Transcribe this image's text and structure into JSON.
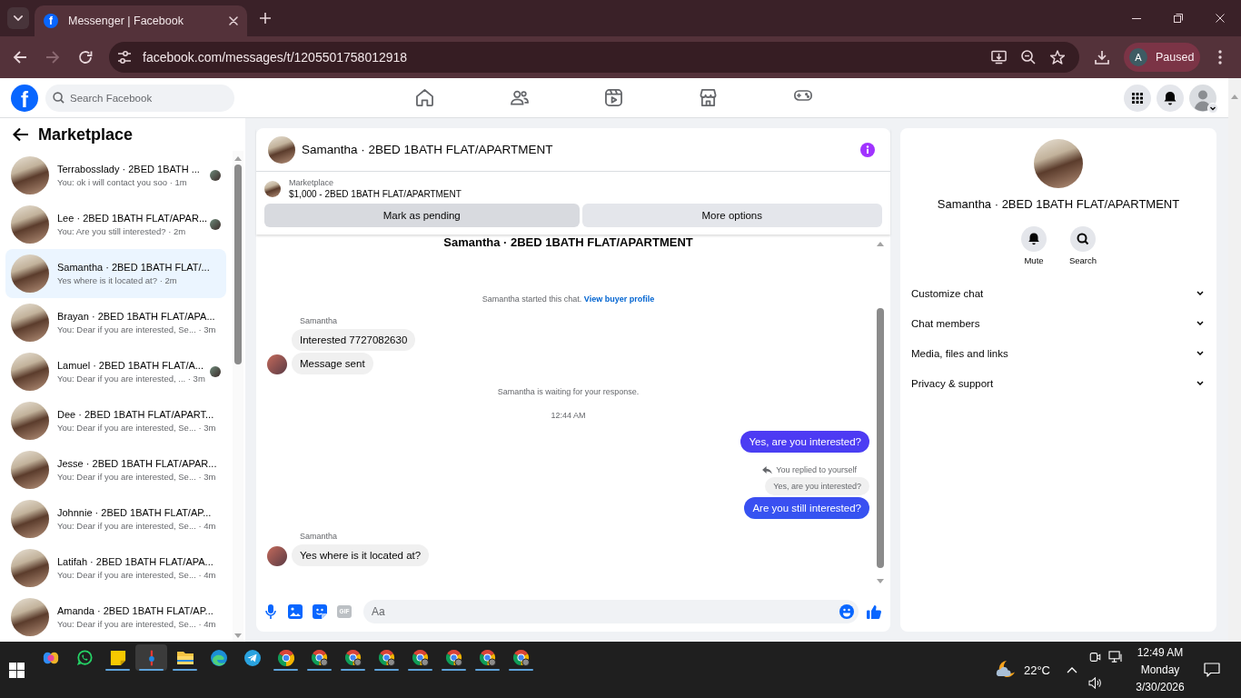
{
  "browser": {
    "tabs": [
      {
        "favicon_text": "f",
        "title": "Messenger | Facebook",
        "selected": true
      }
    ],
    "url": "facebook.com/messages/t/1205501758012918",
    "forward_disabled": true,
    "profile": {
      "initial": "A",
      "status": "Paused"
    }
  },
  "facebook": {
    "logo_text": "f",
    "search_placeholder": "Search Facebook"
  },
  "sidebar": {
    "title": "Marketplace",
    "conversations": [
      {
        "title": "Terrabosslady · 2BED 1BATH ...",
        "preview": "You: ok i will contact you soo · 1m",
        "selected": false,
        "seen": true
      },
      {
        "title": "Lee · 2BED 1BATH FLAT/APAR...",
        "preview": "You: Are you still interested? · 2m",
        "selected": false,
        "seen": true
      },
      {
        "title": "Samantha · 2BED 1BATH FLAT/...",
        "preview": "Yes where is it located at? · 2m",
        "selected": true,
        "seen": false
      },
      {
        "title": "Brayan · 2BED 1BATH FLAT/APA...",
        "preview": "You: Dear if you are interested, Se... · 3m",
        "selected": false,
        "seen": false
      },
      {
        "title": "Lamuel · 2BED 1BATH FLAT/A...",
        "preview": "You: Dear if you are interested, ... · 3m",
        "selected": false,
        "seen": true
      },
      {
        "title": "Dee · 2BED 1BATH FLAT/APART...",
        "preview": "You: Dear if you are interested, Se... · 3m",
        "selected": false,
        "seen": false
      },
      {
        "title": "Jesse · 2BED 1BATH FLAT/APAR...",
        "preview": "You: Dear if you are interested, Se... · 3m",
        "selected": false,
        "seen": false
      },
      {
        "title": "Johnnie · 2BED 1BATH FLAT/AP...",
        "preview": "You: Dear if you are interested, Se... · 4m",
        "selected": false,
        "seen": false
      },
      {
        "title": "Latifah · 2BED 1BATH FLAT/APA...",
        "preview": "You: Dear if you are interested, Se... · 4m",
        "selected": false,
        "seen": false
      },
      {
        "title": "Amanda · 2BED 1BATH FLAT/AP...",
        "preview": "You: Dear if you are interested, Se... · 4m",
        "selected": false,
        "seen": false
      }
    ]
  },
  "chat": {
    "title": "Samantha · 2BED 1BATH FLAT/APARTMENT",
    "listing": {
      "label": "Marketplace",
      "name": "$1,000 - 2BED 1BATH FLAT/APARTMENT"
    },
    "actions": [
      {
        "kind": "primary",
        "label": "Mark as pending"
      },
      {
        "kind": "secondary",
        "label": "More options"
      }
    ],
    "thread_title": "Samantha · 2BED 1BATH FLAT/APARTMENT",
    "messages": [
      {
        "kind": "notice",
        "text": "Samantha started this chat.",
        "link": "View buyer profile"
      },
      {
        "kind": "sender",
        "text": "Samantha"
      },
      {
        "kind": "incoming",
        "text": "Interested 7727082630",
        "avatar": false
      },
      {
        "kind": "incoming",
        "text": "Message sent",
        "avatar": true
      },
      {
        "kind": "notice",
        "text": "Samantha is waiting for your response."
      },
      {
        "kind": "timestamp",
        "text": "12:44 AM"
      },
      {
        "kind": "outgoing",
        "text": "Yes, are you interested?"
      },
      {
        "kind": "reply_note",
        "text": "You replied to yourself",
        "quote": "Yes, are you interested?"
      },
      {
        "kind": "outgoing",
        "text": "Are you still interested?"
      },
      {
        "kind": "sender",
        "text": "Samantha"
      },
      {
        "kind": "incoming",
        "text": "Yes where is it located at?",
        "avatar": true
      }
    ],
    "composer": {
      "gif_label": "GIF",
      "placeholder": "Aa"
    }
  },
  "details": {
    "title": "Samantha · 2BED 1BATH FLAT/APARTMENT",
    "actions": [
      {
        "kind": "mute",
        "label": "Mute"
      },
      {
        "kind": "search",
        "label": "Search"
      }
    ],
    "sections": [
      {
        "label": "Customize chat",
        "expanded": false
      },
      {
        "label": "Chat members",
        "expanded": false
      },
      {
        "label": "Media, files and links",
        "expanded": false
      },
      {
        "label": "Privacy & support",
        "expanded": false
      }
    ]
  },
  "taskbar": {
    "apps": [
      {
        "kind": "assistant",
        "running": false,
        "active": false
      },
      {
        "kind": "chat",
        "running": false,
        "active": false
      },
      {
        "kind": "notes",
        "running": true,
        "active": false
      },
      {
        "kind": "pin",
        "running": true,
        "active": true
      },
      {
        "kind": "folder",
        "running": true,
        "active": false
      },
      {
        "kind": "swirl",
        "running": false,
        "active": false
      },
      {
        "kind": "plane",
        "running": false,
        "active": false
      },
      {
        "kind": "browser",
        "running": true,
        "active": false
      },
      {
        "kind": "browser_profile",
        "running": true,
        "active": false
      },
      {
        "kind": "browser_profile",
        "running": true,
        "active": false
      },
      {
        "kind": "browser_profile",
        "running": true,
        "active": false
      },
      {
        "kind": "browser_profile",
        "running": true,
        "active": false
      },
      {
        "kind": "browser_profile",
        "running": true,
        "active": false
      },
      {
        "kind": "browser_profile",
        "running": true,
        "active": false
      },
      {
        "kind": "browser_profile",
        "running": true,
        "active": false
      }
    ],
    "weather": {
      "temperature": "22°C"
    },
    "clock": {
      "time": "12:49 AM",
      "day": "Monday",
      "date": "3/30/2026"
    }
  }
}
